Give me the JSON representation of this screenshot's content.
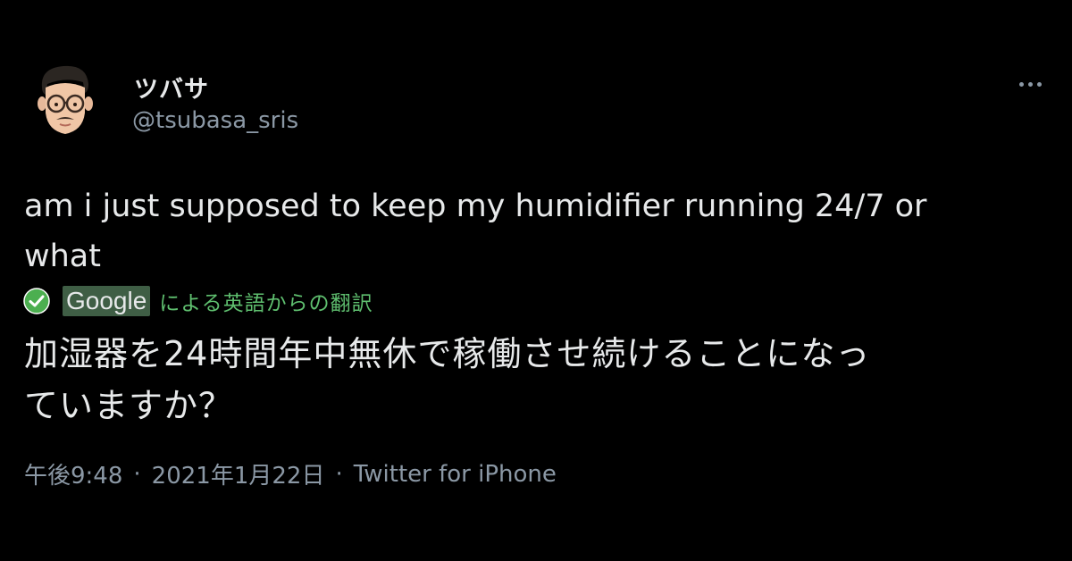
{
  "user": {
    "display_name": "ツバサ",
    "handle": "@tsubasa_sris",
    "avatar_icon": "memoji-avatar-icon"
  },
  "tweet": {
    "text": "am i just supposed to keep my humidifier running 24/7 or\nwhat",
    "translation": {
      "provider": "Google",
      "label": "による英語からの翻訳",
      "icon": "check-circle-icon",
      "text": "加湿器を24時間年中無休で稼働させ続けることになっ\nていますか？"
    },
    "time": "午後9:48",
    "date": "2021年1月22日",
    "source": "Twitter for iPhone",
    "separator": "·"
  },
  "colors": {
    "background": "#000000",
    "text": "#e7e9ea",
    "secondary": "#8b98a5",
    "translation_green": "#5fbf6f",
    "google_bg": "#3f5e45"
  }
}
